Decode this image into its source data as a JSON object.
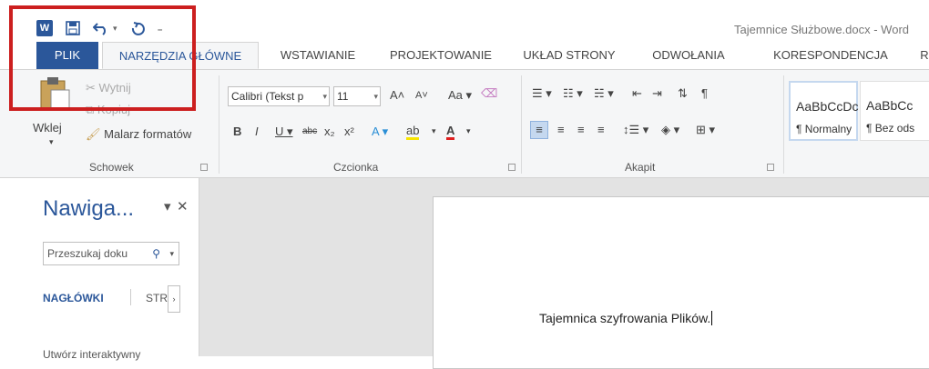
{
  "titlebar": {
    "app_icon_letter": "W",
    "document_title": "Tajemnice Służbowe.docx - Word",
    "qat": [
      "save-icon",
      "undo-icon",
      "redo-icon",
      "customize-icon"
    ]
  },
  "tabs": [
    "PLIK",
    "NARZĘDZIA GŁÓWNE",
    "WSTAWIANIE",
    "PROJEKTOWANIE",
    "UKŁAD STRONY",
    "ODWOŁANIA",
    "KORESPONDENCJA",
    "R"
  ],
  "ribbon": {
    "clipboard": {
      "paste": "Wklej",
      "cut": "Wytnij",
      "copy": "Kopiuj",
      "format_painter": "Malarz formatów",
      "label": "Schowek"
    },
    "font": {
      "font_name": "Calibri (Tekst p",
      "font_size": "11",
      "label": "Czcionka"
    },
    "paragraph": {
      "label": "Akapit"
    },
    "styles": [
      {
        "sample": "AaBbCcDc",
        "name": "¶ Normalny"
      },
      {
        "sample": "AaBbCc",
        "name": "¶ Bez ods"
      }
    ]
  },
  "nav": {
    "title": "Nawiga...",
    "search_placeholder": "Przeszukaj doku",
    "tab_headings": "NAGŁÓWKI",
    "tab_pages": "STR",
    "body_text": "Utwórz interaktywny"
  },
  "document": {
    "text": "Tajemnica szyfrowania Plików."
  },
  "colors": {
    "accent": "#2b579a",
    "highlight": "#cc1f1f"
  }
}
